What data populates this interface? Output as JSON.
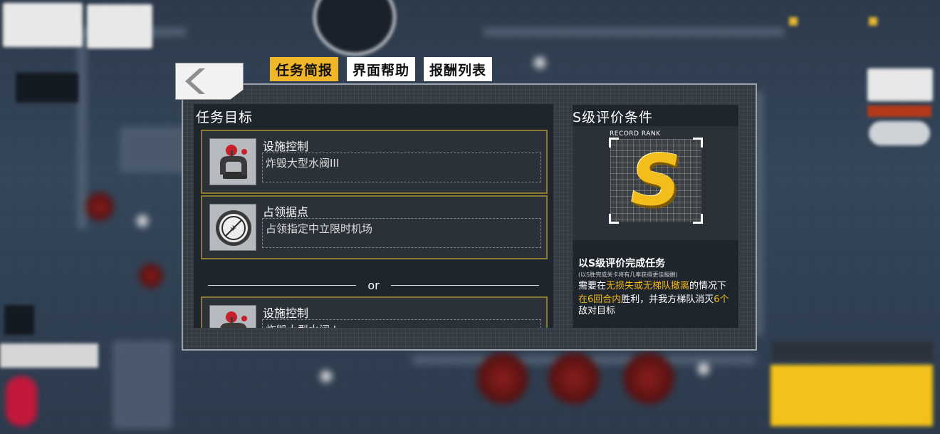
{
  "tabs": [
    {
      "label": "任务简报",
      "active": true
    },
    {
      "label": "界面帮助",
      "active": false
    },
    {
      "label": "报酬列表",
      "active": false
    }
  ],
  "objectives": {
    "title": "任务目标",
    "items": [
      {
        "name": "设施控制",
        "desc": "炸毁大型水阀III",
        "icon": "valve-icon"
      },
      {
        "name": "占领据点",
        "desc": "占领指定中立限时机场",
        "icon": "airport-icon"
      },
      {
        "name": "设施控制",
        "desc": "炸毁大型水阀 I",
        "icon": "valve-icon"
      }
    ],
    "separator": "or"
  },
  "rank": {
    "title": "S级评价条件",
    "label": "RECORD RANK",
    "letter": "S",
    "headline": "以S级评价完成任务",
    "note": "(以S胜完成关卡将有几率获得更佳报酬)",
    "line1_a": "需要在",
    "line1_hl": "无损失或无梯队撤离",
    "line1_b": "的情况下",
    "line2_hl": "在6回合内",
    "line2_b": "胜利，并我方梯队消灭",
    "line2_hl2": "6个",
    "line2_c": "敌对目标"
  },
  "colors": {
    "accent": "#f1b52a",
    "panel": "#353b42",
    "card_border": "#8a7a32",
    "highlight": "#f3b81c"
  }
}
